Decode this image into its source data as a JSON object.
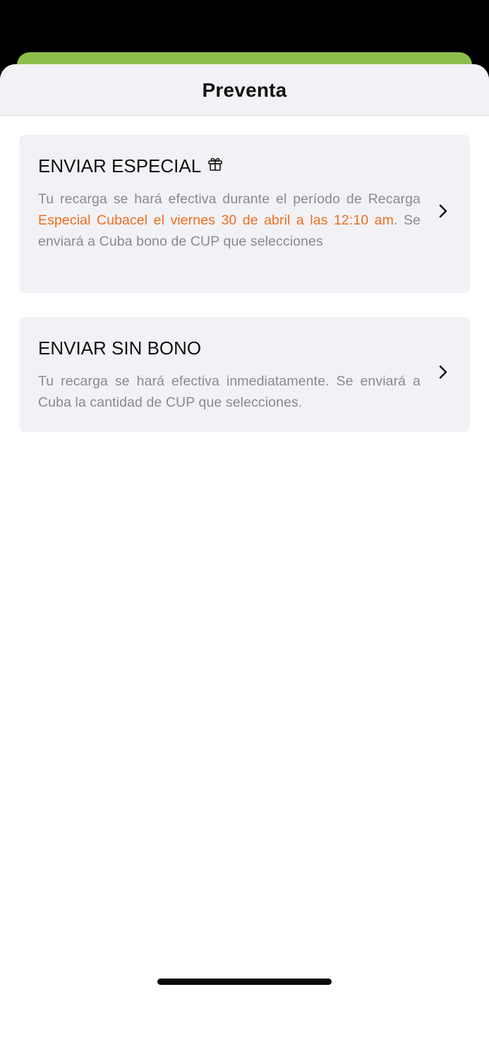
{
  "sheet": {
    "title": "Preventa"
  },
  "options": [
    {
      "title": "ENVIAR ESPECIAL",
      "icon": "gift-icon",
      "desc_before": "Tu recarga se hará efectiva durante el período de Recarga ",
      "desc_highlight": "Especial Cubacel el viernes 30 de abril a las 12:10 am",
      "desc_after": ". Se enviará a Cuba bono de CUP que selecciones",
      "chevron_icon": "chevron-right-icon"
    },
    {
      "title": "ENVIAR SIN BONO",
      "desc": "Tu recarga se hará efectiva inmediatamente. Se enviará a Cuba la cantidad de CUP que selecciones.",
      "chevron_icon": "chevron-right-icon"
    }
  ],
  "colors": {
    "accent_orange": "#f26d1f",
    "behind_sheet_green": "#8cbf4a",
    "card_background": "#f2f2f6",
    "secondary_text": "#8a8a8e"
  }
}
